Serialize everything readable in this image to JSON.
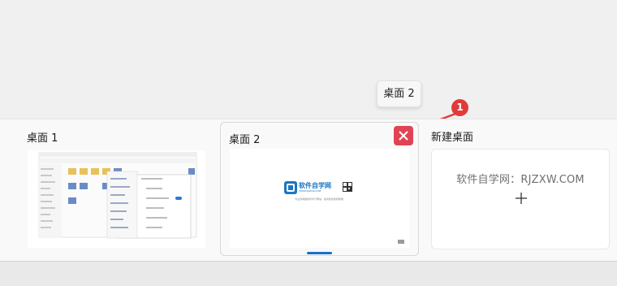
{
  "tooltip": {
    "text": "桌面 2"
  },
  "desktops": [
    {
      "label": "桌面 1"
    },
    {
      "label": "桌面 2"
    }
  ],
  "new_desktop": {
    "label": "新建桌面",
    "watermark": "软件自学网：RJZXW.COM"
  },
  "thumbnail_logo": {
    "title": "软件自学网",
    "url": "WWW.RJZXW.COM",
    "subtitle": "专业的电脑软件学习网站 · 提供免费视频教程"
  },
  "annotation": {
    "badge_number": "1",
    "color": "#e23a3a"
  },
  "colors": {
    "close_button": "#e04454",
    "active_indicator": "#1b6fc7"
  }
}
